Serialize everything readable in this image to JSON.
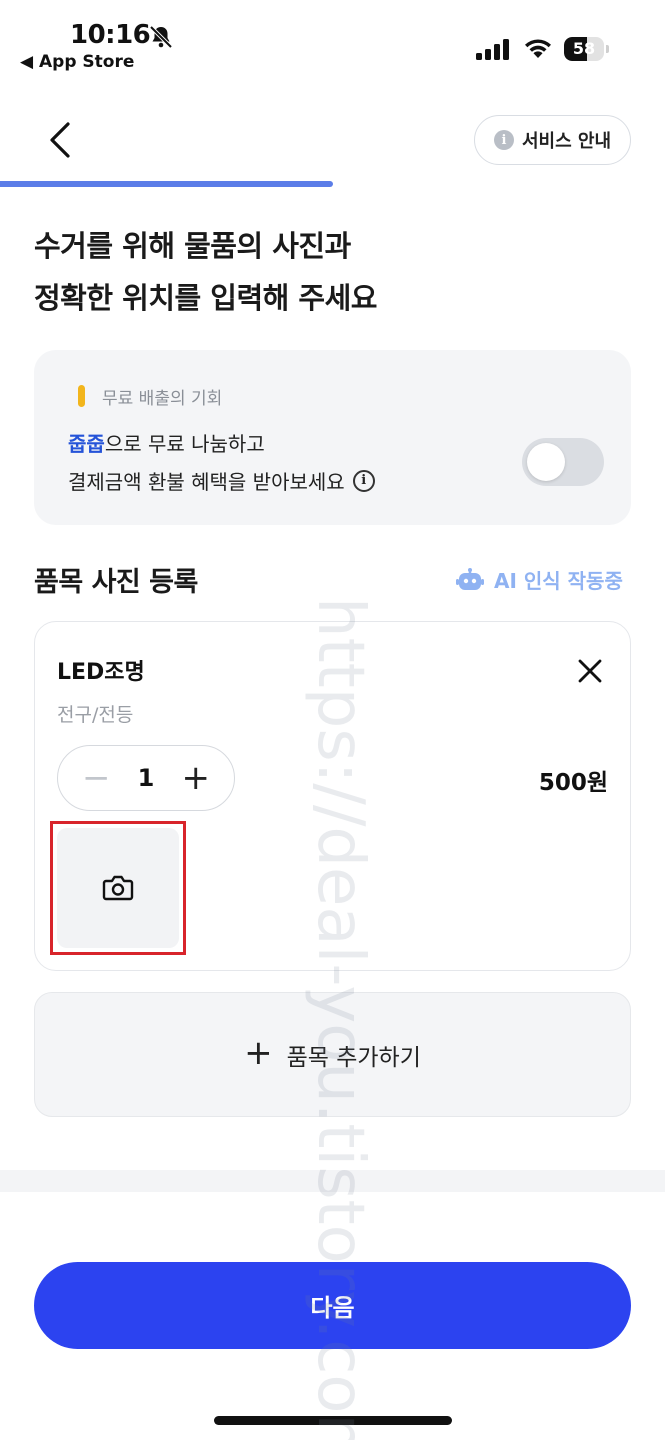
{
  "status_bar": {
    "time": "10:16",
    "back_app": "◀ App Store",
    "battery": "58",
    "battery_level": 0.58
  },
  "header": {
    "service_guide_label": "서비스 안내",
    "info_glyph": "i",
    "progress": 0.5
  },
  "headline": {
    "line1": "수거를 위해 물품의 사진과",
    "line2": "정확한 위치를 입력해 주세요"
  },
  "promo": {
    "label": "무료 배출의 기회",
    "brand": "줍줍",
    "line1_rest": "으로 무료 나눔하고",
    "line2": "결제금액 환불 혜택을 받아보세요",
    "info_glyph": "i",
    "toggle_on": false
  },
  "section": {
    "title": "품목 사진 등록",
    "ai_status": "AI 인식 작동중"
  },
  "item": {
    "name": "LED조명",
    "category": "전구/전등",
    "quantity": "1",
    "minus": "−",
    "plus": "+",
    "price": "500원"
  },
  "add_item": {
    "plus": "+",
    "label": "품목 추가하기"
  },
  "next_button": "다음",
  "watermark": "https://deal-you.tistory.com",
  "colors": {
    "primary": "#2c43f0",
    "progress": "#5b7de8",
    "brand_text": "#2453d8",
    "ai_text": "#8fb2f2",
    "highlight": "#d8242b",
    "coin": "#f2b51c"
  },
  "icons": [
    "bell-slash-icon",
    "signal-icon",
    "wifi-icon",
    "battery-icon",
    "back-chevron-icon",
    "info-icon",
    "coin-icon",
    "robot-icon",
    "close-icon",
    "camera-icon",
    "plus-icon"
  ]
}
